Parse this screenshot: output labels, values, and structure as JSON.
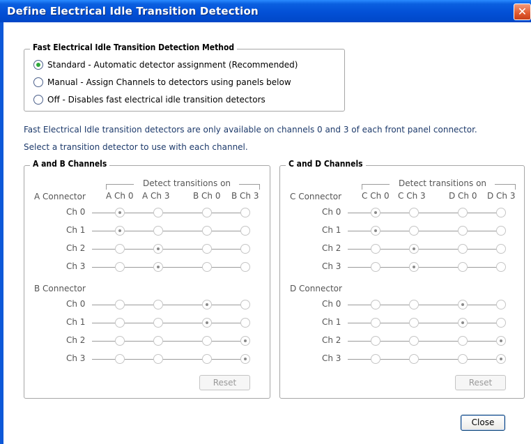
{
  "window": {
    "title": "Define Electrical Idle Transition Detection",
    "close_glyph": "✕"
  },
  "method": {
    "legend": "Fast Electrical Idle Transition Detection Method",
    "options": [
      {
        "label": "Standard - Automatic detector assignment (Recommended)",
        "selected": true
      },
      {
        "label": "Manual - Assign Channels to detectors using panels below",
        "selected": false
      },
      {
        "label": "Off - Disables fast electrical idle transition detectors",
        "selected": false
      }
    ]
  },
  "info": {
    "line1": "Fast Electrical Idle transition detectors are only available on channels 0 and 3 of each front panel connector.",
    "line2": "Select a transition detector to use with each channel."
  },
  "panels": [
    {
      "legend": "A and B Channels",
      "detect_label": "Detect transitions on",
      "columns": [
        "A Ch 0",
        "A Ch 3",
        "B Ch 0",
        "B Ch 3"
      ],
      "connectors": [
        {
          "name": "A Connector",
          "rows": [
            {
              "label": "Ch 0",
              "selected": 0
            },
            {
              "label": "Ch 1",
              "selected": 0
            },
            {
              "label": "Ch 2",
              "selected": 1
            },
            {
              "label": "Ch 3",
              "selected": 1
            }
          ]
        },
        {
          "name": "B Connector",
          "rows": [
            {
              "label": "Ch 0",
              "selected": 2
            },
            {
              "label": "Ch 1",
              "selected": 2
            },
            {
              "label": "Ch 2",
              "selected": 3
            },
            {
              "label": "Ch 3",
              "selected": 3
            }
          ]
        }
      ],
      "reset_label": "Reset"
    },
    {
      "legend": "C and D Channels",
      "detect_label": "Detect transitions on",
      "columns": [
        "C Ch 0",
        "C Ch 3",
        "D Ch 0",
        "D Ch 3"
      ],
      "connectors": [
        {
          "name": "C Connector",
          "rows": [
            {
              "label": "Ch 0",
              "selected": 0
            },
            {
              "label": "Ch 1",
              "selected": 0
            },
            {
              "label": "Ch 2",
              "selected": 1
            },
            {
              "label": "Ch 3",
              "selected": 1
            }
          ]
        },
        {
          "name": "D Connector",
          "rows": [
            {
              "label": "Ch 0",
              "selected": 2
            },
            {
              "label": "Ch 1",
              "selected": 2
            },
            {
              "label": "Ch 2",
              "selected": 3
            },
            {
              "label": "Ch 3",
              "selected": 3
            }
          ]
        }
      ],
      "reset_label": "Reset"
    }
  ],
  "close_button": "Close"
}
